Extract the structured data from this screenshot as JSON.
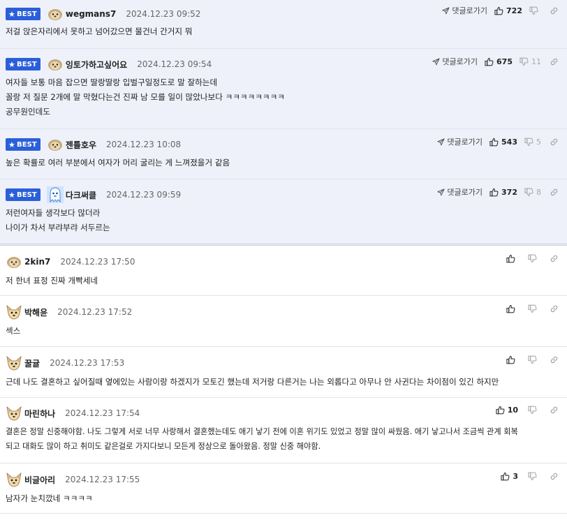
{
  "best_comments": [
    {
      "badge": "BEST",
      "nickname": "wegmans7",
      "date": "2024.12.23 09:52",
      "lines": [
        "저걸 앉은자리에서 못하고 넘어갔으면 물건너 간거지 뭐"
      ],
      "reply_label": "댓글로가기",
      "likes": "722",
      "dislikes": ""
    },
    {
      "badge": "BEST",
      "nickname": "잉토가하고싶어요",
      "date": "2024.12.23 09:54",
      "lines": [
        "여자들 보통 마음 잡으면 딸랑딸랑 입벌구일정도로 말 잘하는데",
        "꼴랑 저 질문 2개에 말 막혔다는건 진짜 남 모를 일이 많았나보다 ㅋㅋㅋㅋㅋㅋㅋㅋ",
        "공무원인데도"
      ],
      "reply_label": "댓글로가기",
      "likes": "675",
      "dislikes": "11"
    },
    {
      "badge": "BEST",
      "nickname": "젠틀호우",
      "date": "2024.12.23 10:08",
      "lines": [
        "높은 확률로 여러 부분에서 여자가 머리 굴리는 게 느껴졌을거 같음"
      ],
      "reply_label": "댓글로가기",
      "likes": "543",
      "dislikes": "5"
    },
    {
      "badge": "BEST",
      "nickname": "다크써클",
      "date": "2024.12.23 09:59",
      "lines": [
        "저런여자들 생각보다 많더라",
        "나이가 차서 부랴부랴 서두르는"
      ],
      "reply_label": "댓글로가기",
      "likes": "372",
      "dislikes": "8"
    }
  ],
  "comments": [
    {
      "nickname": "2kin7",
      "date": "2024.12.23 17:50",
      "lines": [
        "저 한녀 표정 진짜 개빡세네"
      ],
      "likes": ""
    },
    {
      "nickname": "박해윤",
      "date": "2024.12.23 17:52",
      "lines": [
        "섹스"
      ],
      "likes": ""
    },
    {
      "nickname": "꿀귤",
      "date": "2024.12.23 17:53",
      "lines": [
        "근데 나도 결혼하고 싶어질때 옆에있는 사람이랑 하겠지가 모토긴 했는데 저거랑 다른거는 나는 외롭다고 아무나 안 사귄다는 차이점이 있긴 하지만"
      ],
      "likes": ""
    },
    {
      "nickname": "마린하나",
      "date": "2024.12.23 17:54",
      "lines": [
        "결혼은 정말 신중해야함. 나도 그렇게 서로 너무 사랑해서 결혼했는데도 애기 낳기 전에 이혼 위기도 있었고 정말 많이 싸웠음. 애기 낳고나서 조금씩 관계 회복",
        "되고 대화도 많이 하고 취미도 같은걸로 가지다보니 모든게 정상으로 돌아왔음. 정말 신중 해야함."
      ],
      "likes": "10"
    },
    {
      "nickname": "비글아리",
      "date": "2024.12.23 17:55",
      "lines": [
        "남자가 눈치깠네 ㅋㅋㅋㅋ"
      ],
      "likes": "3"
    }
  ],
  "colors": {
    "best_badge": "#2b5fd9",
    "best_background": "#eef1fa",
    "divider": "#dfe3ea"
  },
  "icons": {
    "reply": "paper-plane-icon",
    "like": "thumbs-up-icon",
    "dislike": "thumbs-down-icon",
    "link": "link-icon",
    "avatar_default": "puppy-avatar",
    "avatar_dog": "chihuahua-avatar",
    "avatar_custom": "ghost-avatar"
  }
}
